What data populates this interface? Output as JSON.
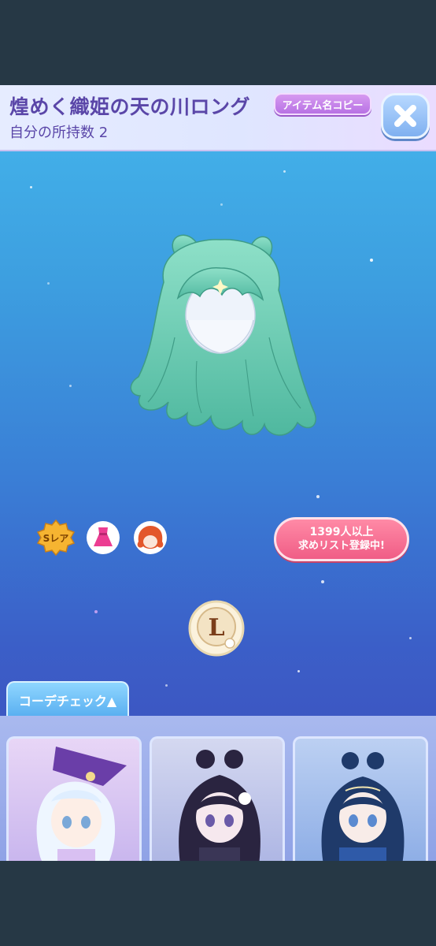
{
  "header": {
    "title": "煌めく織姫の天の川ロング",
    "owned_label": "自分の所持数",
    "owned_count": "2",
    "copy_button": "アイテム名コピー"
  },
  "badges": {
    "rarity": "Sレア"
  },
  "wishlist": {
    "count_text": "1399人以上",
    "status_text": "求めリスト登録中!"
  },
  "shop_badge": {
    "letter": "L"
  },
  "coordinate": {
    "tab_label": "コーデチェック▲"
  },
  "colors": {
    "header_text": "#5a46a8",
    "hair": "#6cc9b1",
    "wish_pill": "#f05d86",
    "background_top": "#44b6ec",
    "background_bottom": "#4048b8"
  }
}
